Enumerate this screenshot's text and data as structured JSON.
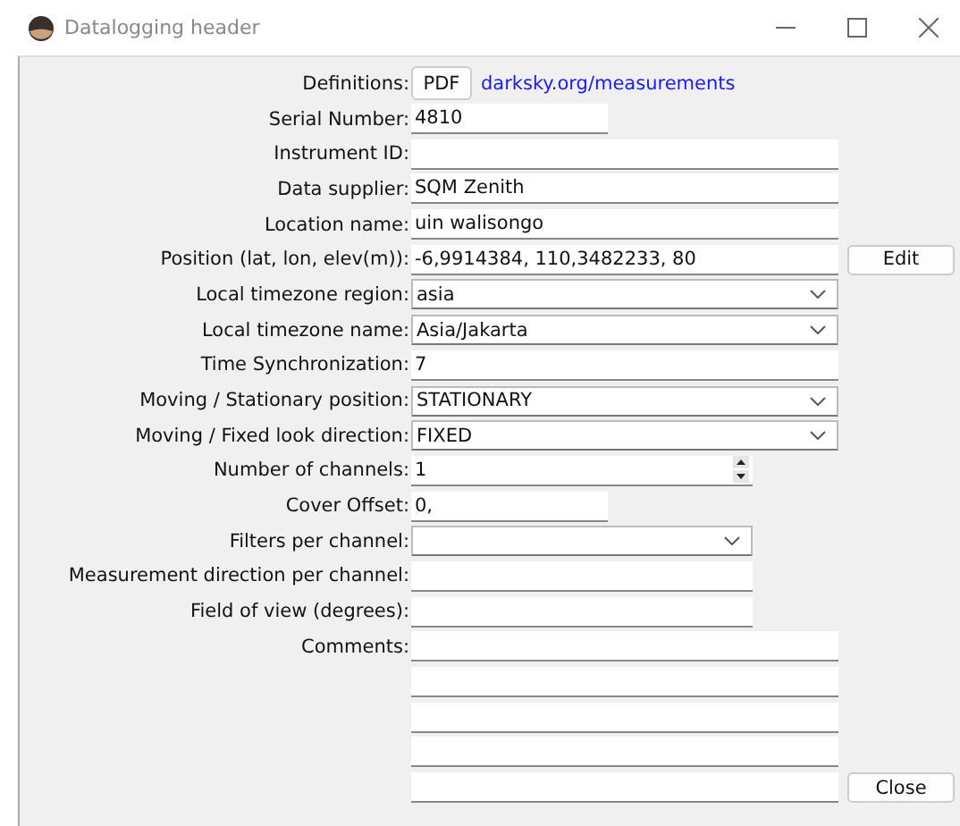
{
  "window": {
    "title": "Datalogging header"
  },
  "rows": [
    {
      "label": "Definitions:",
      "kind": "pdf_link",
      "button": "PDF",
      "link": "darksky.org/measurements"
    },
    {
      "label": "Serial Number:",
      "kind": "short_entry",
      "value": "4810"
    },
    {
      "label": "Instrument ID:",
      "kind": "entry"
    },
    {
      "label": "Data supplier:",
      "kind": "entry",
      "value": "SQM Zenith"
    },
    {
      "label": "Location name:",
      "kind": "entry",
      "value": "uin walisongo"
    },
    {
      "label": "Position (lat, lon, elev(m)):",
      "kind": "entry",
      "value": "-6,9914384, 110,3482233, 80",
      "button": "Edit"
    },
    {
      "label": "Local timezone region:",
      "kind": "combo",
      "value": "asia"
    },
    {
      "label": "Local timezone name:",
      "kind": "combo",
      "value": "Asia/Jakarta"
    },
    {
      "label": "Time Synchronization:",
      "kind": "entry",
      "value": "7"
    },
    {
      "label": "Moving / Stationary position:",
      "kind": "combo",
      "value": "STATIONARY"
    },
    {
      "label": "Moving / Fixed look direction:",
      "kind": "combo",
      "value": "FIXED"
    },
    {
      "label": "Number of channels:",
      "kind": "spin",
      "value": "1"
    },
    {
      "label": "Cover Offset:",
      "kind": "short_entry",
      "value": "0,"
    },
    {
      "label": "Filters per channel:",
      "kind": "medium_combo"
    },
    {
      "label": "Measurement direction per channel:",
      "kind": "medium_entry"
    },
    {
      "label": "Field of view (degrees):",
      "kind": "medium_entry"
    },
    {
      "label": "Comments:",
      "kind": "entry"
    },
    {
      "kind": "entry"
    },
    {
      "kind": "entry"
    },
    {
      "kind": "entry"
    },
    {
      "kind": "entry",
      "button": "Close"
    }
  ]
}
